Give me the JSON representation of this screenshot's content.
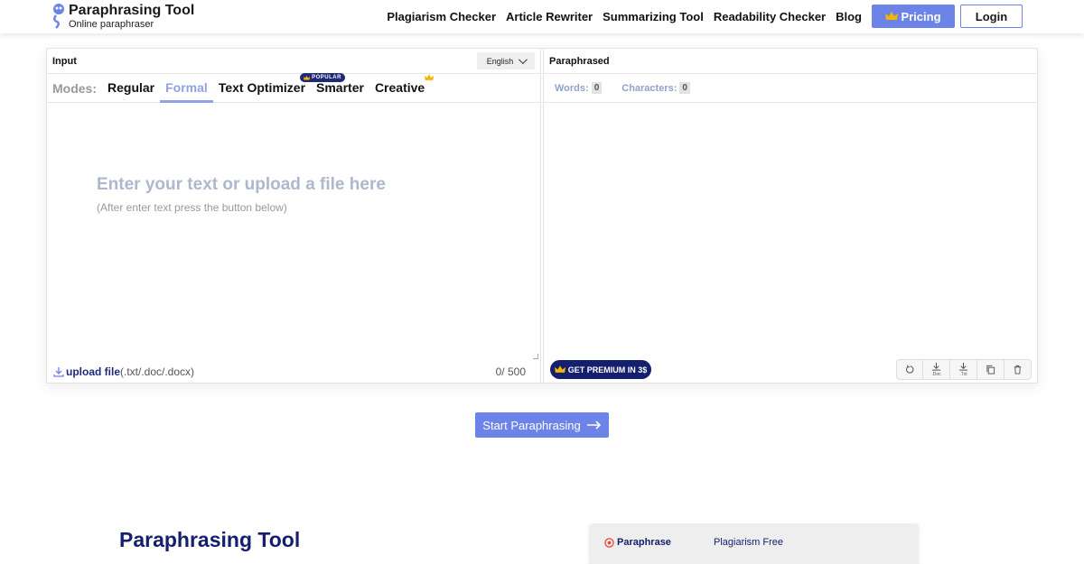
{
  "brand": {
    "title": "Paraphrasing Tool",
    "subtitle": "Online paraphraser"
  },
  "nav": {
    "links": [
      "Plagiarism Checker",
      "Article Rewriter",
      "Summarizing Tool",
      "Readability Checker",
      "Blog"
    ],
    "pricing_label": "Pricing",
    "login_label": "Login"
  },
  "input_pane": {
    "title": "Input",
    "language": "English",
    "modes_label": "Modes:",
    "modes": [
      "Regular",
      "Formal",
      "Text Optimizer",
      "Smarter",
      "Creative"
    ],
    "active_mode": "Formal",
    "popular_badge": "POPULAR",
    "placeholder": "Enter your text or upload a file here",
    "placeholder_sub": "(After enter text press the button below)",
    "upload_label": "upload file",
    "upload_formats": "(.txt/.doc/.docx)",
    "counter": "0/ 500"
  },
  "output_pane": {
    "title": "Paraphrased",
    "words_label": "Words:",
    "words_value": "0",
    "chars_label": "Characters:",
    "chars_value": "0",
    "premium_label": "GET PREMIUM IN 3$",
    "tool_doc_label": ".Doc",
    "tool_txt_label": ".Txt"
  },
  "start_button": "Start Paraphrasing",
  "section": {
    "title": "Paraphrasing Tool",
    "tabs": [
      "Paraphrase",
      "Plagiarism Free"
    ]
  },
  "colors": {
    "accent": "#6c84e8",
    "navy": "#14206e",
    "crown": "#f5b400"
  }
}
